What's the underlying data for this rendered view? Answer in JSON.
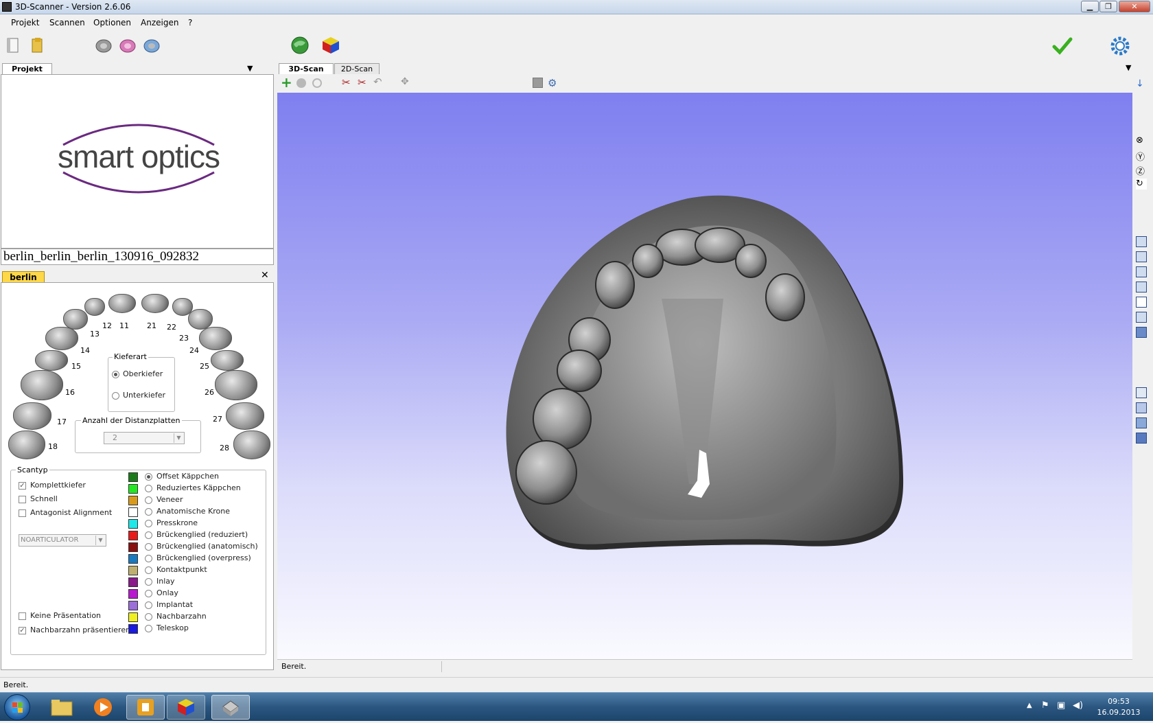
{
  "window": {
    "title": "3D-Scanner  -  Version 2.6.06"
  },
  "menu": {
    "items": [
      "Projekt",
      "Scannen",
      "Optionen",
      "Anzeigen",
      "?"
    ]
  },
  "project_panel": {
    "tab_label": "Projekt",
    "logo_text": "smart optics",
    "project_name": "berlin_berlin_berlin_130916_092832"
  },
  "case_panel": {
    "tab_label": "berlin",
    "close_glyph": "✕",
    "teeth_upper_right": [
      "11",
      "12",
      "13",
      "14",
      "15",
      "16",
      "17",
      "18"
    ],
    "teeth_upper_left": [
      "21",
      "22",
      "23",
      "24",
      "25",
      "26",
      "27",
      "28"
    ],
    "kieferart": {
      "title": "Kieferart",
      "options": [
        {
          "label": "Oberkiefer",
          "selected": true
        },
        {
          "label": "Unterkiefer",
          "selected": false
        }
      ]
    },
    "distanzplatten": {
      "title": "Anzahl der Distanzplatten",
      "value": "2"
    },
    "scantyp": {
      "title": "Scantyp",
      "checks": [
        {
          "label": "Komplettkiefer",
          "checked": true
        },
        {
          "label": "Schnell",
          "checked": false
        },
        {
          "label": "Antagonist Alignment",
          "checked": false
        }
      ],
      "articulator": "NOARTICULATOR",
      "bottom_checks": [
        {
          "label": "Keine Präsentation",
          "checked": false
        },
        {
          "label": "Nachbarzahn präsentieren",
          "checked": true
        }
      ],
      "types": [
        {
          "label": "Offset Käppchen",
          "color": "#1a7a1a",
          "selected": true
        },
        {
          "label": "Reduziertes Käppchen",
          "color": "#22e822",
          "selected": false
        },
        {
          "label": "Veneer",
          "color": "#d99a1c",
          "selected": false
        },
        {
          "label": "Anatomische Krone",
          "color": "#ffffff",
          "selected": false
        },
        {
          "label": "Presskrone",
          "color": "#1ee8e8",
          "selected": false
        },
        {
          "label": "Brückenglied (reduziert)",
          "color": "#e81a1a",
          "selected": false
        },
        {
          "label": "Brückenglied (anatomisch)",
          "color": "#8a1010",
          "selected": false
        },
        {
          "label": "Brückenglied (overpress)",
          "color": "#1a7ac0",
          "selected": false
        },
        {
          "label": "Kontaktpunkt",
          "color": "#bfb070",
          "selected": false
        },
        {
          "label": "Inlay",
          "color": "#8a1a8a",
          "selected": false
        },
        {
          "label": "Onlay",
          "color": "#b81ad0",
          "selected": false
        },
        {
          "label": "Implantat",
          "color": "#9b6ed8",
          "selected": false
        },
        {
          "label": "Nachbarzahn",
          "color": "#f0f020",
          "selected": false
        },
        {
          "label": "Teleskop",
          "color": "#1a1ae0",
          "selected": false
        }
      ]
    }
  },
  "view": {
    "tabs": [
      {
        "label": "3D-Scan",
        "active": true
      },
      {
        "label": "2D-Scan",
        "active": false
      }
    ],
    "status": "Bereit."
  },
  "statusbar": {
    "text": "Bereit."
  },
  "taskbar": {
    "time": "09:53",
    "date": "16.09.2013"
  }
}
